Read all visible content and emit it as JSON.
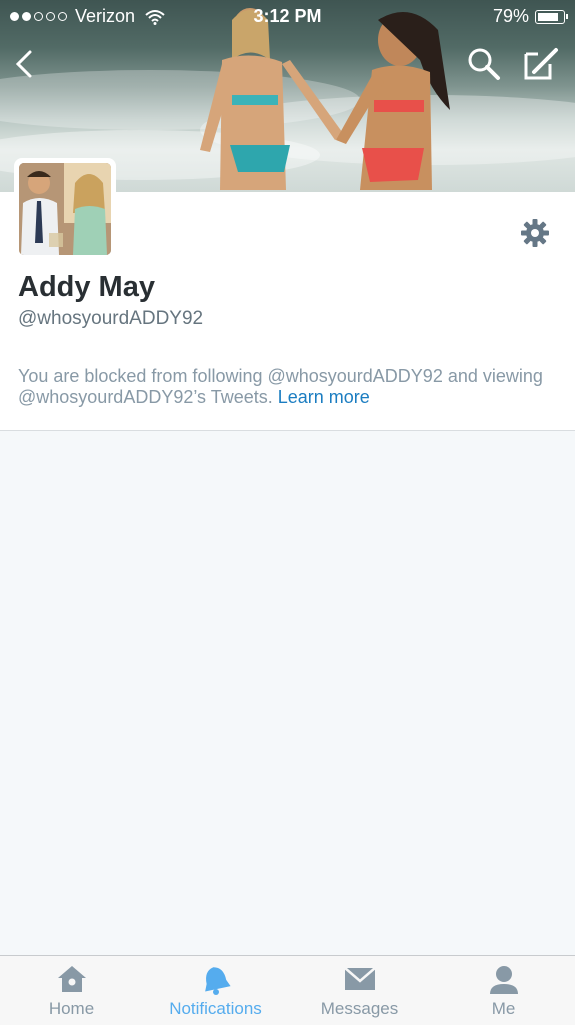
{
  "status_bar": {
    "carrier": "Verizon",
    "time": "3:12 PM",
    "battery": "79%"
  },
  "profile": {
    "name": "Addy May",
    "handle": "@whosyourdADDY92",
    "blocked_message": "You are blocked from following @whosyourdADDY92 and viewing @whosyourdADDY92’s Tweets.",
    "learn_more": "Learn more"
  },
  "tabs": [
    {
      "label": "Home",
      "icon": "home-icon"
    },
    {
      "label": "Notifications",
      "icon": "bell-icon",
      "active": true
    },
    {
      "label": "Messages",
      "icon": "envelope-icon"
    },
    {
      "label": "Me",
      "icon": "person-icon"
    }
  ],
  "colors": {
    "accent": "#55acee",
    "link": "#1b7dc1",
    "muted": "#8899a6",
    "text": "#292f33"
  }
}
